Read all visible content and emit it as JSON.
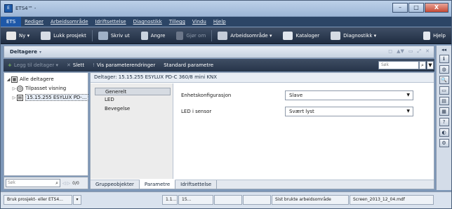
{
  "window": {
    "title": "ETS4™ - ",
    "minimize": "–",
    "maximize": "□",
    "close": "X"
  },
  "menu": {
    "app": "ETS",
    "items": [
      "Rediger",
      "Arbeidsområde",
      "Idriftsettelse",
      "Diagnostikk",
      "Tillegg",
      "Vindu",
      "Hjelp"
    ]
  },
  "toolbar": {
    "new": "Ny ▾",
    "close_project": "Lukk prosjekt",
    "print": "Skriv ut",
    "undo": "Angre",
    "redo": "Gjør om",
    "workspace": "Arbeidsområde ▾",
    "catalogs": "Kataloger",
    "diagnostics": "Diagnostikk ▾",
    "help": "Hjelp"
  },
  "panel": {
    "title": "Deltagere",
    "title_caret": "▾",
    "add_devices": "Legg til deltager ▾",
    "delete": "Slett",
    "show_param_changes": "Vis parameterendringer",
    "default_params": "Standard parametre",
    "search_placeholder": "Søk",
    "head_tools": [
      "◻",
      "▲▼",
      "▭",
      "⤢",
      "✕"
    ]
  },
  "tree": {
    "items": [
      {
        "label": "Alle deltagere",
        "toggle": "◢",
        "icon": "▦"
      },
      {
        "label": "Tilpasset visning",
        "toggle": "▷",
        "icon": "◎"
      },
      {
        "label": "15.15.255  ESYLUX PD-...",
        "toggle": "▷",
        "icon": "▤"
      }
    ],
    "search_placeholder": "Søk",
    "nav": "◁ ▷",
    "count": "0/0"
  },
  "main": {
    "header": "Deltager: 15.15.255  ESYLUX PD-C 360/8 mini KNX",
    "categories": [
      "Generelt",
      "LED",
      "Bevegelse"
    ],
    "selected_category": 0,
    "params": [
      {
        "label": "Enhetskonfigurasjon",
        "value": "Slave"
      },
      {
        "label": "LED i sensor",
        "value": "Svært lyst"
      }
    ],
    "tabs": [
      "Gruppeobjekter",
      "Parametre",
      "Idriftsettelse"
    ],
    "active_tab": 1
  },
  "dock": {
    "collapse": "◂◂",
    "icons": [
      "ℹ",
      "◍",
      "🔍",
      "▭",
      "▤",
      "▦",
      "?",
      "◐",
      "⚙"
    ]
  },
  "statusbar": {
    "mode": "Bruk prosjekt- eller ETS4...",
    "dropdown": "▾",
    "cell_a": "1.1...",
    "cell_b": "15...",
    "cell_c": "",
    "cell_d": "",
    "last_workspace": "Sist brukte arbeidsområde",
    "workspace_file": "Screen_2013_12_04.mdf"
  },
  "colors": {
    "menubar": "#2c4566",
    "toolbar": "#263449",
    "accent": "#1e58a8"
  }
}
